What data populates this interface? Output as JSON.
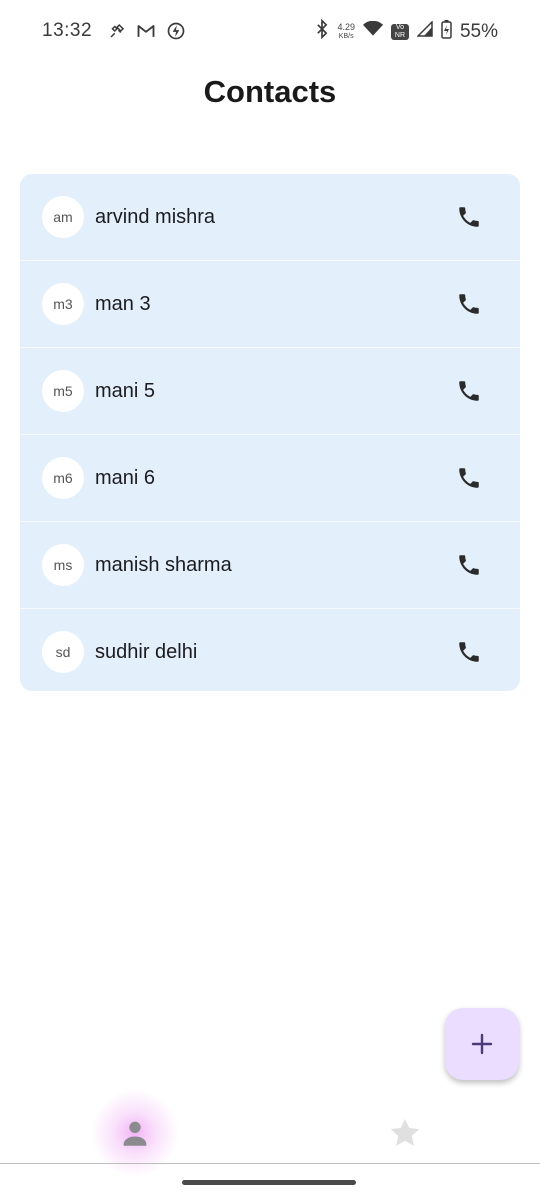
{
  "status_bar": {
    "time": "13:32",
    "speed_value": "4.29",
    "speed_unit": "KB/s",
    "volte_line1": "Vo",
    "volte_line2": "NR",
    "battery": "55%"
  },
  "header": {
    "title": "Contacts"
  },
  "contacts": [
    {
      "initials": "am",
      "name": "arvind mishra"
    },
    {
      "initials": "m3",
      "name": "man 3"
    },
    {
      "initials": "m5",
      "name": "mani 5"
    },
    {
      "initials": "m6",
      "name": "mani 6"
    },
    {
      "initials": "ms",
      "name": "manish sharma"
    },
    {
      "initials": "sd",
      "name": "sudhir delhi"
    }
  ],
  "fab": {
    "icon": "plus-icon"
  },
  "bottom_nav": {
    "items": [
      {
        "icon": "person-icon",
        "selected": true
      },
      {
        "icon": "star-icon",
        "selected": false
      }
    ]
  },
  "colors": {
    "card_background": "#e3f0fc",
    "fab_background": "#eaddff",
    "fab_icon": "#4a3a7a",
    "nav_selected_glow": "#e878f0"
  }
}
